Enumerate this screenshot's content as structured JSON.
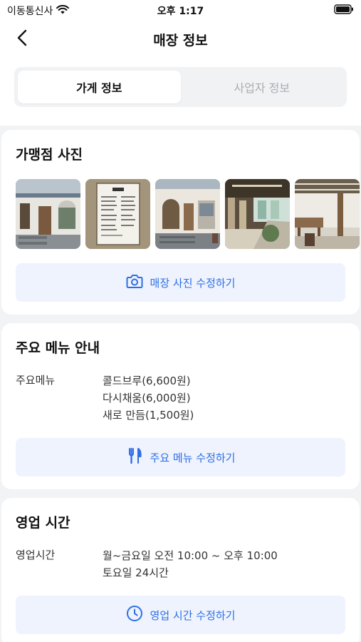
{
  "status": {
    "carrier": "이동통신사",
    "time": "오후 1:17"
  },
  "nav": {
    "title": "매장 정보"
  },
  "tabs": [
    {
      "label": "가게 정보",
      "active": true
    },
    {
      "label": "사업자 정보",
      "active": false
    }
  ],
  "photos_section": {
    "title": "가맹점 사진",
    "photo_count": 5,
    "edit_label": "매장 사진 수정하기"
  },
  "menu_section": {
    "title": "주요 메뉴 안내",
    "label": "주요메뉴",
    "items": [
      "콜드브루(6,600원)",
      "다시채움(6,000원)",
      "새로 만듬(1,500원)"
    ],
    "edit_label": "주요 메뉴 수정하기"
  },
  "hours_section": {
    "title": "영업 시간",
    "label": "영업시간",
    "items": [
      "월~금요일 오전 10:00 ~ 오후 10:00",
      "토요일 24시간"
    ],
    "edit_label": "영업 시간 수정하기"
  },
  "colors": {
    "accent": "#2f6ee6",
    "button_bg": "#eef3fd",
    "page_bg": "#f2f3f5"
  },
  "icons": [
    "wifi-icon",
    "battery-icon",
    "back-arrow-icon",
    "camera-icon",
    "fork-knife-icon",
    "clock-icon"
  ]
}
